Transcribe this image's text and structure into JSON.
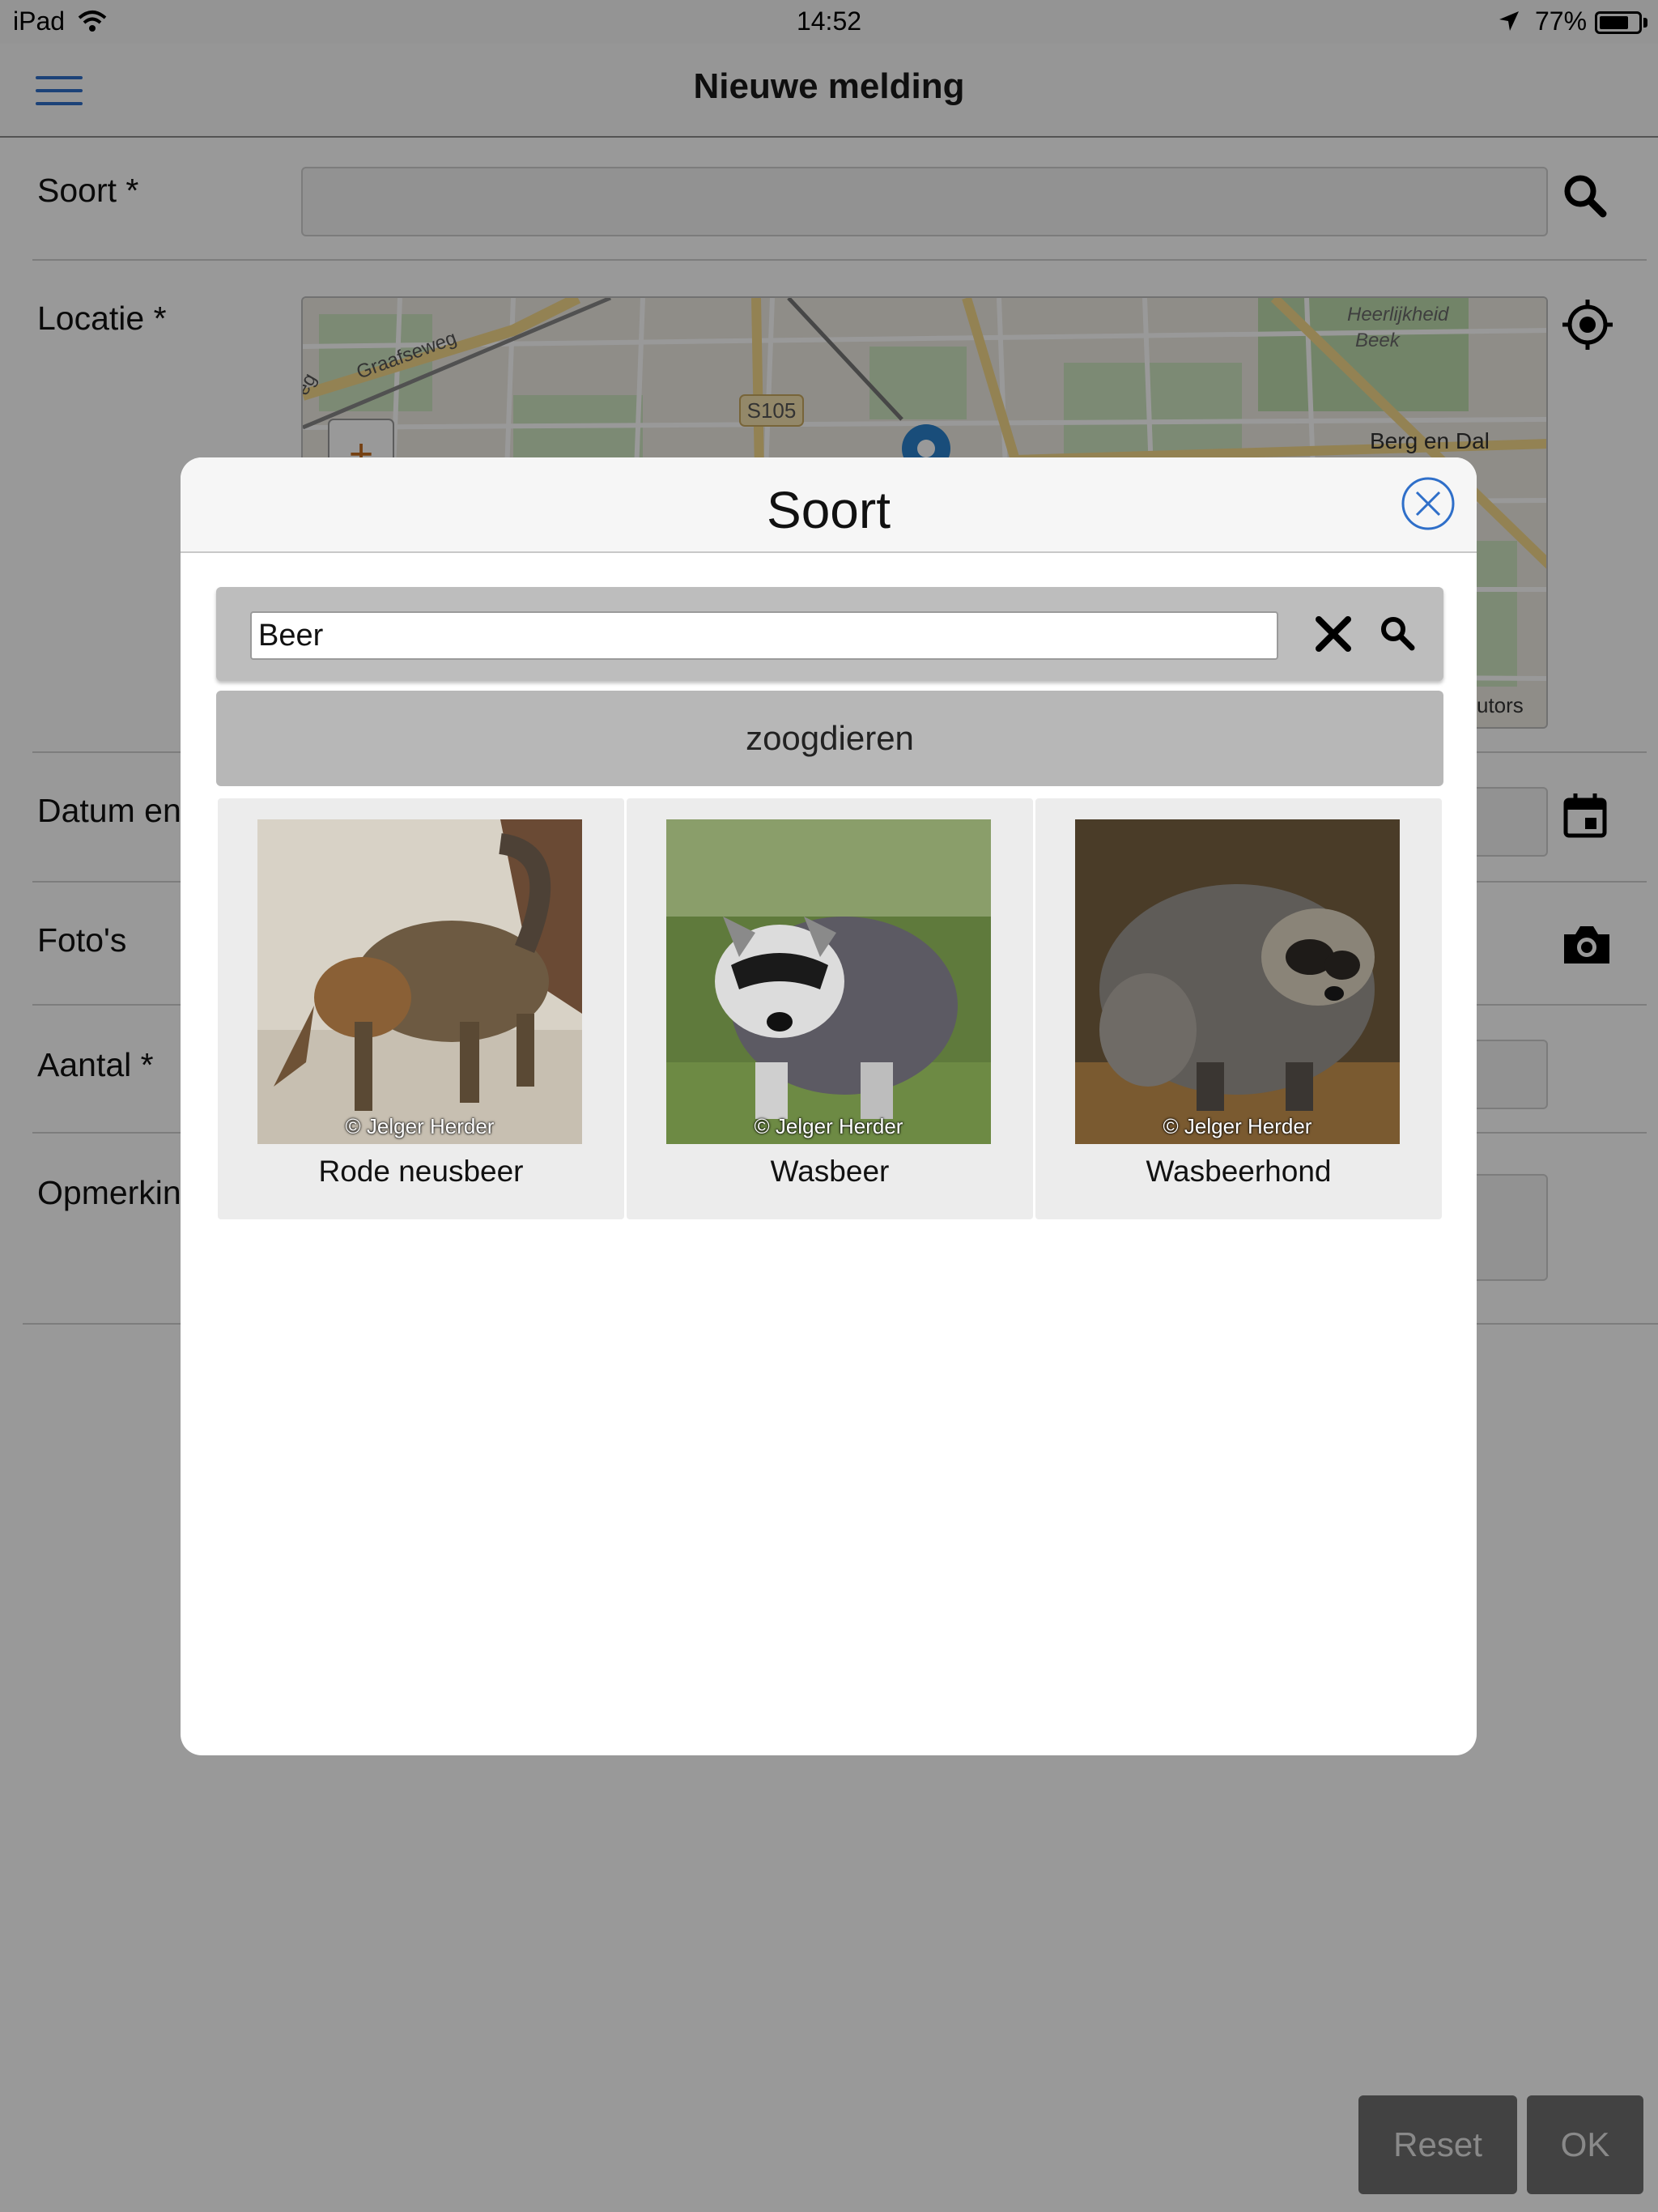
{
  "status_bar": {
    "device": "iPad",
    "time": "14:52",
    "battery_percent": "77%",
    "battery_level": 0.77
  },
  "header": {
    "title": "Nieuwe melding"
  },
  "form": {
    "soort_label": "Soort *",
    "locatie_label": "Locatie *",
    "datum_label": "Datum en",
    "fotos_label": "Foto's",
    "aantal_label": "Aantal *",
    "opmerkingen_label": "Opmerkin"
  },
  "map": {
    "road_label_1": "Graafseweg",
    "road_label_2": "eg",
    "route_label": "S105",
    "place_label_1": "Heerlijkheid",
    "place_label_2": "Beek",
    "place_label_3": "Berg en Dal",
    "zoom_in_label": "+",
    "attribution": "utors"
  },
  "footer": {
    "reset_label": "Reset",
    "ok_label": "OK"
  },
  "modal": {
    "title": "Soort",
    "search_value": "Beer",
    "category": "zoogdieren",
    "results": [
      {
        "name": "Rode neusbeer",
        "credit": "© Jelger Herder"
      },
      {
        "name": "Wasbeer",
        "credit": "© Jelger Herder"
      },
      {
        "name": "Wasbeerhond",
        "credit": "© Jelger Herder"
      }
    ]
  },
  "colors": {
    "accent": "#2f6fc9",
    "overlay": "rgba(0,0,0,0.40)",
    "button": "#6f6f6f"
  }
}
